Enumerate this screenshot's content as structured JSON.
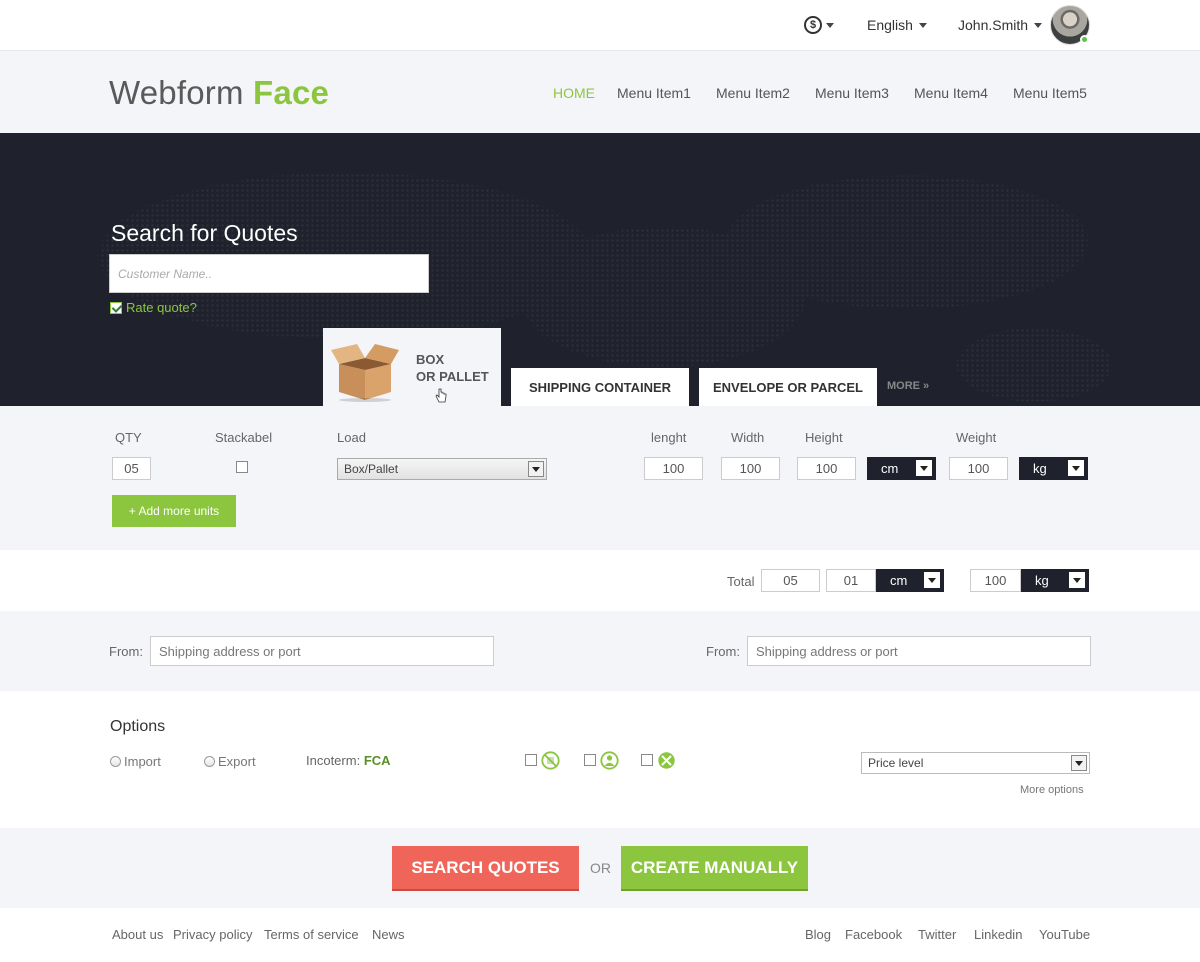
{
  "topbar": {
    "currency_icon": "dollar-coin-icon",
    "language": "English",
    "username": "John.Smith",
    "online_color": "#5bc04a"
  },
  "header": {
    "logo_main": "Webform",
    "logo_accent": "Face",
    "nav": [
      "HOME",
      "Menu Item1",
      "Menu Item2",
      "Menu Item3",
      "Menu Item4",
      "Menu Item5"
    ],
    "accent_color": "#8cc63f"
  },
  "hero": {
    "title": "Search for Quotes",
    "customer_placeholder": "Customer Name..",
    "rate_quote_label": "Rate quote?",
    "rate_quote_checked": true,
    "tabs": {
      "box_pallet_line1": "BOX",
      "box_pallet_line2": "OR PALLET",
      "shipping_container": "SHIPPING CONTAINER",
      "envelope_parcel": "ENVELOPE OR PARCEL",
      "more": "MORE »"
    }
  },
  "units": {
    "labels": {
      "qty": "QTY",
      "stackabel": "Stackabel",
      "load": "Load",
      "lenght": "lenght",
      "width": "Width",
      "height": "Height",
      "weight": "Weight"
    },
    "qty": "05",
    "load": "Box/Pallet",
    "lenght": "100",
    "width": "100",
    "height": "100",
    "dim_unit": "cm",
    "weight": "100",
    "weight_unit": "kg",
    "add_more": "+ Add more units"
  },
  "total": {
    "label": "Total",
    "qty": "05",
    "dim": "01",
    "dim_unit": "cm",
    "weight": "100",
    "weight_unit": "kg"
  },
  "address": {
    "from_label_1": "From:",
    "from_label_2": "From:",
    "placeholder_1": "Shipping address or port",
    "placeholder_2": "Shipping address or port"
  },
  "options": {
    "title": "Options",
    "import": "Import",
    "export": "Export",
    "incoterm_label": "Incoterm:",
    "incoterm_value": "FCA",
    "icons": [
      "no-stack-icon",
      "person-icon",
      "crossed-tools-icon"
    ],
    "price_level": "Price level",
    "more_options": "More options"
  },
  "actions": {
    "search": "SEARCH QUOTES",
    "or": "OR",
    "create": "CREATE MANUALLY",
    "search_color": "#f0655a",
    "create_color": "#8cc63f"
  },
  "footer": {
    "left": [
      "About us",
      "Privacy policy",
      "Terms of service",
      "News"
    ],
    "right": [
      "Blog",
      "Facebook",
      "Twitter",
      "Linkedin",
      "YouTube"
    ]
  }
}
